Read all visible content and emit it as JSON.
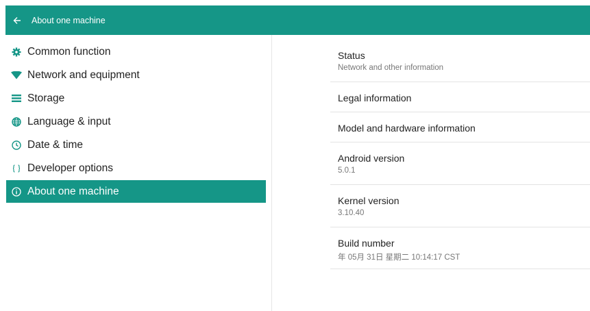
{
  "appbar": {
    "title": "About one machine"
  },
  "sidebar": {
    "items": [
      {
        "label": "Common function",
        "icon": "gear-icon"
      },
      {
        "label": "Network and equipment",
        "icon": "wifi-icon"
      },
      {
        "label": "Storage",
        "icon": "storage-icon"
      },
      {
        "label": "Language & input",
        "icon": "globe-icon"
      },
      {
        "label": "Date & time",
        "icon": "clock-icon"
      },
      {
        "label": "Developer options",
        "icon": "braces-icon"
      },
      {
        "label": "About one machine",
        "icon": "info-icon",
        "selected": true
      }
    ]
  },
  "main": {
    "prefs": [
      {
        "title": "Status",
        "summary": "Network and other information"
      },
      {
        "title": "Legal information",
        "summary": ""
      },
      {
        "title": "Model and hardware information",
        "summary": ""
      },
      {
        "title": "Android version",
        "summary": "5.0.1"
      },
      {
        "title": "Kernel version",
        "summary": "3.10.40"
      },
      {
        "title": "Build number",
        "summary": "年 05月 31日 星期二 10:14:17 CST"
      }
    ]
  },
  "colors": {
    "accent": "#159687",
    "text": "#222222",
    "secondary_text": "#777777",
    "divider": "#e3e3e3"
  }
}
